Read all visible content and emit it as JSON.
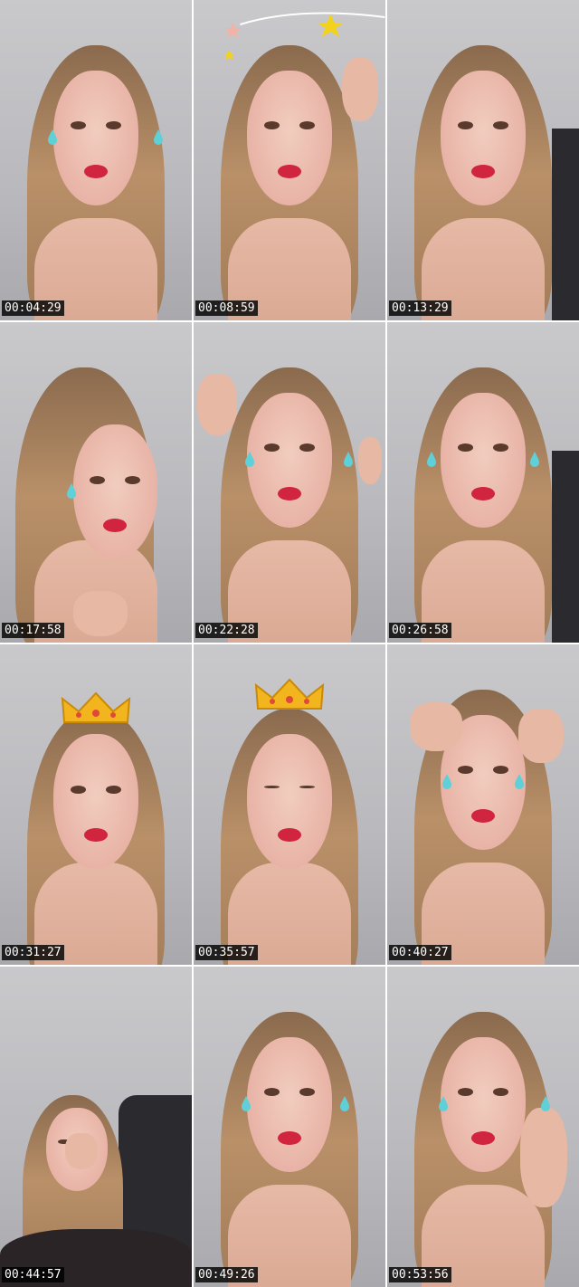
{
  "frames": [
    {
      "timestamp": "00:04:29",
      "overlay": "tears"
    },
    {
      "timestamp": "00:08:59",
      "overlay": "stars"
    },
    {
      "timestamp": "00:13:29",
      "overlay": "none"
    },
    {
      "timestamp": "00:17:58",
      "overlay": "tears"
    },
    {
      "timestamp": "00:22:28",
      "overlay": "tears"
    },
    {
      "timestamp": "00:26:58",
      "overlay": "tears"
    },
    {
      "timestamp": "00:31:27",
      "overlay": "crown"
    },
    {
      "timestamp": "00:35:57",
      "overlay": "crown"
    },
    {
      "timestamp": "00:40:27",
      "overlay": "tears"
    },
    {
      "timestamp": "00:44:57",
      "overlay": "none"
    },
    {
      "timestamp": "00:49:26",
      "overlay": "tears"
    },
    {
      "timestamp": "00:53:56",
      "overlay": "tears"
    }
  ],
  "colors": {
    "background": "#ffffff",
    "timestamp_bg": "#000000",
    "timestamp_fg": "#ffffff",
    "crown": "#f2b51d",
    "tear": "#5fd0d8",
    "lips": "#d0243f"
  }
}
